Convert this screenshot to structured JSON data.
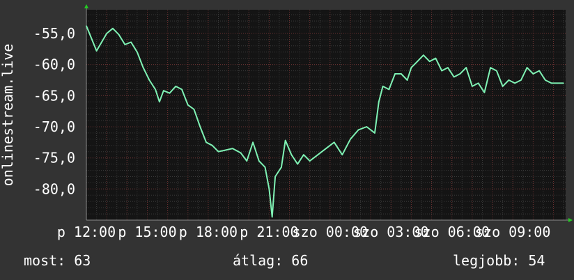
{
  "chart_data": {
    "type": "line",
    "ylabel": "onlinestream.live",
    "xlabel": "",
    "title": "",
    "y_tick_labels": [
      "-55,0",
      "-60,0",
      "-65,0",
      "-70,0",
      "-75,0",
      "-80,0"
    ],
    "y_ticks": [
      -55,
      -60,
      -65,
      -70,
      -75,
      -80
    ],
    "ylim": [
      -85,
      -51.2
    ],
    "x_tick_labels": [
      "p 12:00",
      "p 15:00",
      "p 18:00",
      "p 21:00",
      "szo 00:00",
      "szo 03:00",
      "szo 06:00",
      "szo 09:00"
    ],
    "x_ticks_hours": [
      12,
      15,
      18,
      21,
      24,
      27,
      30,
      33
    ],
    "xlim_hours": [
      12,
      35.6
    ],
    "x_unit": "hours since Friday 00:00",
    "grid": true,
    "legend": "none",
    "series": [
      {
        "color": "#7ff2b4",
        "x": [
          12.0,
          12.5,
          13.0,
          13.3,
          13.6,
          13.9,
          14.2,
          14.5,
          14.8,
          15.1,
          15.4,
          15.6,
          15.8,
          16.1,
          16.4,
          16.7,
          17.0,
          17.3,
          17.6,
          17.9,
          18.2,
          18.5,
          18.8,
          19.2,
          19.6,
          19.9,
          20.2,
          20.5,
          20.8,
          21.0,
          21.15,
          21.3,
          21.6,
          21.8,
          22.1,
          22.4,
          22.7,
          23.0,
          23.4,
          23.8,
          24.2,
          24.6,
          25.0,
          25.4,
          25.8,
          26.2,
          26.4,
          26.6,
          26.9,
          27.2,
          27.5,
          27.8,
          28.0,
          28.3,
          28.6,
          28.9,
          29.2,
          29.5,
          29.8,
          30.1,
          30.4,
          30.7,
          31.0,
          31.3,
          31.6,
          31.9,
          32.2,
          32.5,
          32.8,
          33.1,
          33.4,
          33.7,
          34.0,
          34.3,
          34.6,
          34.9,
          35.2,
          35.5
        ],
        "values": [
          -53.8,
          -57.8,
          -55.0,
          -54.2,
          -55.2,
          -56.8,
          -56.4,
          -58.0,
          -60.5,
          -62.5,
          -64.0,
          -66.0,
          -64.2,
          -64.6,
          -63.5,
          -64.0,
          -66.5,
          -67.2,
          -70.0,
          -72.5,
          -73.0,
          -74.0,
          -73.8,
          -73.5,
          -74.2,
          -75.5,
          -72.5,
          -75.5,
          -76.5,
          -80.0,
          -84.5,
          -78.0,
          -76.5,
          -72.2,
          -74.5,
          -76.0,
          -74.5,
          -75.5,
          -74.5,
          -73.5,
          -72.5,
          -74.5,
          -72.0,
          -70.5,
          -70.0,
          -71.0,
          -66.0,
          -63.5,
          -64.0,
          -61.5,
          -61.5,
          -62.5,
          -60.5,
          -59.5,
          -58.5,
          -59.5,
          -59.0,
          -61.0,
          -60.5,
          -62.0,
          -61.5,
          -60.5,
          -63.5,
          -63.0,
          -64.5,
          -60.5,
          -61.0,
          -63.5,
          -62.5,
          -63.0,
          -62.5,
          -60.5,
          -61.5,
          -61.0,
          -62.5,
          -63.0,
          -63.0,
          -63.0
        ]
      }
    ]
  },
  "footer": {
    "now": "most: 63",
    "average": "átlag: 66",
    "best": "legjobb: 54"
  },
  "colors": {
    "background": "#333333",
    "plot_background": "#141414",
    "grid_minor": "#3a3a3a",
    "grid_major": "#6b2f2f",
    "axis": "#8a8a8a",
    "arrow": "#22cc22",
    "line": "#7ff2b4"
  }
}
